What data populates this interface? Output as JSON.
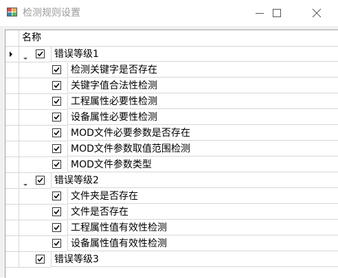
{
  "window": {
    "title": "检测规则设置",
    "controls": {
      "minimize": "minimize-icon",
      "maximize": "maximize-icon",
      "close": "close-icon"
    }
  },
  "tree": {
    "column_header": "名称",
    "groups": [
      {
        "label": "错误等级1",
        "checked": true,
        "expanded": true,
        "children": [
          {
            "label": "检测关键字是否存在",
            "checked": true
          },
          {
            "label": "关键字值合法性检测",
            "checked": true
          },
          {
            "label": "工程属性必要性检测",
            "checked": true
          },
          {
            "label": "设备属性必要性检测",
            "checked": true
          },
          {
            "label": "MOD文件必要参数是否存在",
            "checked": true
          },
          {
            "label": "MOD文件参数取值范围检测",
            "checked": true
          },
          {
            "label": "MOD文件参数类型",
            "checked": true
          }
        ]
      },
      {
        "label": "错误等级2",
        "checked": true,
        "expanded": true,
        "children": [
          {
            "label": "文件夹是否存在",
            "checked": true
          },
          {
            "label": "文件是否存在",
            "checked": true
          },
          {
            "label": "工程属性值有效性检测",
            "checked": true
          },
          {
            "label": "设备属性值有效性检测",
            "checked": true
          }
        ]
      },
      {
        "label": "错误等级3",
        "checked": true,
        "expanded": false,
        "children": []
      }
    ]
  },
  "colors": {
    "grid_line": "#d6d6d6",
    "client_bg": "#f0f0f0",
    "title_text": "#9a9a9a"
  }
}
